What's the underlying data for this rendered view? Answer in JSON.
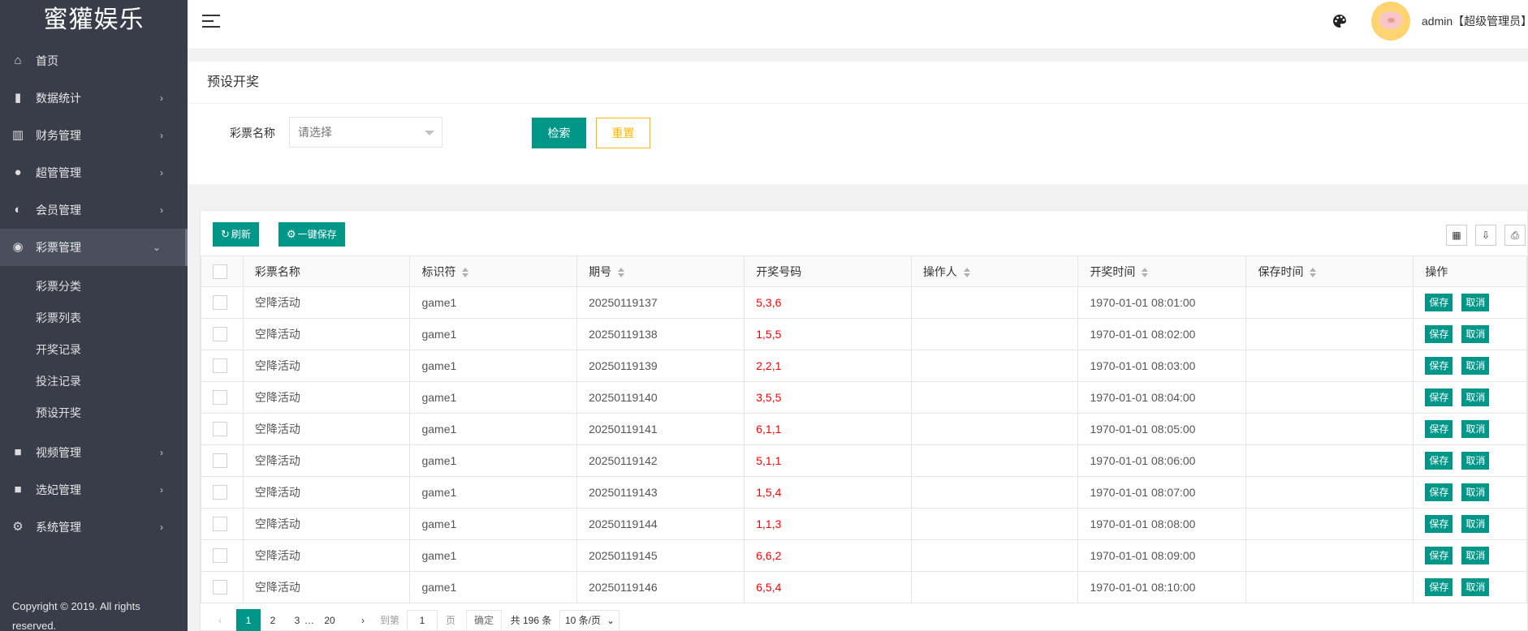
{
  "sidebar": {
    "brand": "蜜獾娱乐",
    "items": [
      {
        "label": "首页",
        "icon": "home-icon",
        "glyph": "⌂",
        "has_arrow": false
      },
      {
        "label": "数据统计",
        "icon": "bar-chart-icon",
        "glyph": "▮",
        "has_arrow": true
      },
      {
        "label": "财务管理",
        "icon": "bank-icon",
        "glyph": "▥",
        "has_arrow": true
      },
      {
        "label": "超管管理",
        "icon": "user-icon",
        "glyph": "●",
        "has_arrow": true
      },
      {
        "label": "会员管理",
        "icon": "users-icon",
        "glyph": "◐",
        "has_arrow": true
      },
      {
        "label": "彩票管理",
        "icon": "gamepad-icon",
        "glyph": "◉",
        "has_arrow": true,
        "open": true
      }
    ],
    "sub_items": [
      "彩票分类",
      "彩票列表",
      "开奖记录",
      "投注记录",
      "预设开奖"
    ],
    "items_after": [
      {
        "label": "视频管理",
        "icon": "video-icon",
        "glyph": "■",
        "has_arrow": true
      },
      {
        "label": "选妃管理",
        "icon": "video-icon",
        "glyph": "■",
        "has_arrow": true
      },
      {
        "label": "系统管理",
        "icon": "gear-icon",
        "glyph": "⚙",
        "has_arrow": true
      }
    ],
    "copyright": "Copyright © 2019. All rights reserved."
  },
  "header": {
    "user_label": "admin【超级管理员】"
  },
  "search": {
    "title": "预设开奖",
    "field_label": "彩票名称",
    "select_placeholder": "请选择",
    "search_label": "检索",
    "reset_label": "重置"
  },
  "toolbar": {
    "refresh_label": "刷新",
    "save_all_label": "一键保存"
  },
  "table": {
    "columns": [
      "彩票名称",
      "标识符",
      "期号",
      "开奖号码",
      "操作人",
      "开奖时间",
      "保存时间",
      "操作"
    ],
    "save_label": "保存",
    "cancel_label": "取消",
    "rows": [
      {
        "name": "空降活动",
        "key": "game1",
        "expect": "20250119137",
        "code": "5,3,6",
        "operator": "",
        "open_time": "1970-01-01 08:01:00",
        "save_time": ""
      },
      {
        "name": "空降活动",
        "key": "game1",
        "expect": "20250119138",
        "code": "1,5,5",
        "operator": "",
        "open_time": "1970-01-01 08:02:00",
        "save_time": ""
      },
      {
        "name": "空降活动",
        "key": "game1",
        "expect": "20250119139",
        "code": "2,2,1",
        "operator": "",
        "open_time": "1970-01-01 08:03:00",
        "save_time": ""
      },
      {
        "name": "空降活动",
        "key": "game1",
        "expect": "20250119140",
        "code": "3,5,5",
        "operator": "",
        "open_time": "1970-01-01 08:04:00",
        "save_time": ""
      },
      {
        "name": "空降活动",
        "key": "game1",
        "expect": "20250119141",
        "code": "6,1,1",
        "operator": "",
        "open_time": "1970-01-01 08:05:00",
        "save_time": ""
      },
      {
        "name": "空降活动",
        "key": "game1",
        "expect": "20250119142",
        "code": "5,1,1",
        "operator": "",
        "open_time": "1970-01-01 08:06:00",
        "save_time": ""
      },
      {
        "name": "空降活动",
        "key": "game1",
        "expect": "20250119143",
        "code": "1,5,4",
        "operator": "",
        "open_time": "1970-01-01 08:07:00",
        "save_time": ""
      },
      {
        "name": "空降活动",
        "key": "game1",
        "expect": "20250119144",
        "code": "1,1,3",
        "operator": "",
        "open_time": "1970-01-01 08:08:00",
        "save_time": ""
      },
      {
        "name": "空降活动",
        "key": "game1",
        "expect": "20250119145",
        "code": "6,6,2",
        "operator": "",
        "open_time": "1970-01-01 08:09:00",
        "save_time": ""
      },
      {
        "name": "空降活动",
        "key": "game1",
        "expect": "20250119146",
        "code": "6,5,4",
        "operator": "",
        "open_time": "1970-01-01 08:10:00",
        "save_time": ""
      }
    ]
  },
  "pager": {
    "prev": "‹",
    "pages": [
      "1",
      "2",
      "3"
    ],
    "ellipsis": "…",
    "last": "20",
    "next": "›",
    "goto_label": "到第",
    "goto_value": "1",
    "page_unit": "页",
    "confirm_label": "确定",
    "total_label": "共 196 条",
    "size_label": "10 条/页"
  },
  "colors": {
    "sidebar": "#393d49",
    "accent": "#009688",
    "warn": "#ffb800",
    "code": "#ff0000"
  }
}
